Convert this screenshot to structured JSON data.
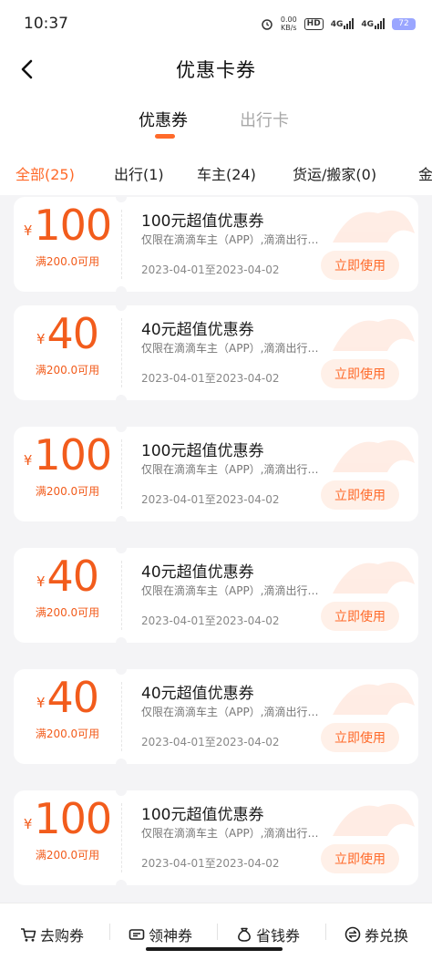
{
  "status_bar": {
    "time": "10:37",
    "net_speed_value": "0.00",
    "net_speed_unit": "KB/s",
    "hd_label": "HD",
    "net1": "4G",
    "net2": "4G",
    "battery": "72",
    "icons": [
      "alarm-icon",
      "hd-icon",
      "signal-icon",
      "battery-icon"
    ]
  },
  "nav": {
    "title": "优惠卡券",
    "back_icon": "chevron-left-icon"
  },
  "tabs": [
    {
      "label": "优惠券",
      "active": true
    },
    {
      "label": "出行卡",
      "active": false
    }
  ],
  "filters": [
    {
      "label": "全部(25)",
      "active": true
    },
    {
      "label": "出行(1)",
      "active": false
    },
    {
      "label": "车主(24)",
      "active": false
    },
    {
      "label": "货运/搬家(0)",
      "active": false
    },
    {
      "label": "金",
      "active": false
    }
  ],
  "coupons": [
    {
      "currency": "¥",
      "amount": "100",
      "condition": "满200.0可用",
      "title": "100元超值优惠券",
      "desc": "仅限在滴滴车主（APP）,滴滴出行…",
      "date": "2023-04-01至2023-04-02",
      "button": "立即使用"
    },
    {
      "currency": "¥",
      "amount": "40",
      "condition": "满200.0可用",
      "title": "40元超值优惠券",
      "desc": "仅限在滴滴车主（APP）,滴滴出行…",
      "date": "2023-04-01至2023-04-02",
      "button": "立即使用"
    },
    {
      "currency": "¥",
      "amount": "100",
      "condition": "满200.0可用",
      "title": "100元超值优惠券",
      "desc": "仅限在滴滴车主（APP）,滴滴出行…",
      "date": "2023-04-01至2023-04-02",
      "button": "立即使用"
    },
    {
      "currency": "¥",
      "amount": "40",
      "condition": "满200.0可用",
      "title": "40元超值优惠券",
      "desc": "仅限在滴滴车主（APP）,滴滴出行…",
      "date": "2023-04-01至2023-04-02",
      "button": "立即使用"
    },
    {
      "currency": "¥",
      "amount": "40",
      "condition": "满200.0可用",
      "title": "40元超值优惠券",
      "desc": "仅限在滴滴车主（APP）,滴滴出行…",
      "date": "2023-04-01至2023-04-02",
      "button": "立即使用"
    },
    {
      "currency": "¥",
      "amount": "100",
      "condition": "满200.0可用",
      "title": "100元超值优惠券",
      "desc": "仅限在滴滴车主（APP）,滴滴出行…",
      "date": "2023-04-01至2023-04-02",
      "button": "立即使用"
    }
  ],
  "bottom_nav": [
    {
      "label": "去购券",
      "icon": "cart-icon"
    },
    {
      "label": "领神券",
      "icon": "ticket-icon"
    },
    {
      "label": "省钱券",
      "icon": "money-bag-icon"
    },
    {
      "label": "券兑换",
      "icon": "exchange-icon"
    }
  ],
  "colors": {
    "accent": "#ff6a2a",
    "amount": "#f25c1c",
    "button_bg": "#fff0e8",
    "page_bg": "#f4f4f6"
  }
}
